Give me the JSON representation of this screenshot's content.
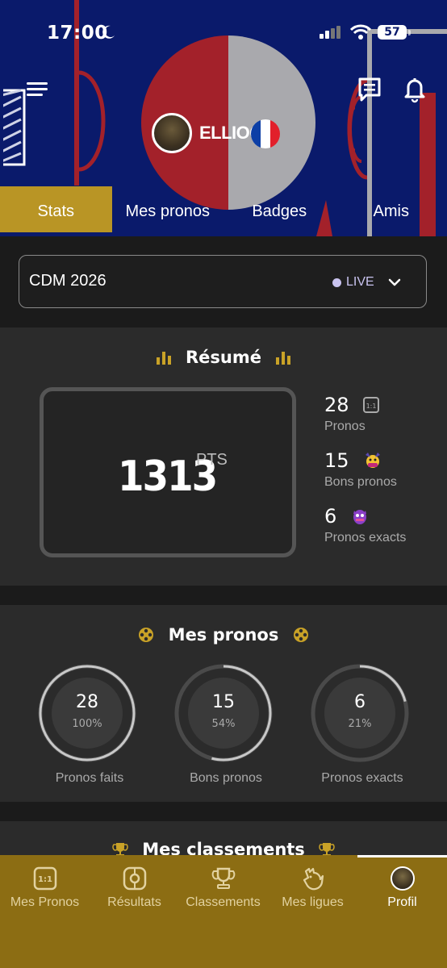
{
  "status_bar": {
    "time": "17:00",
    "battery": "57"
  },
  "profile": {
    "username": "ELLIOOT",
    "country": "France"
  },
  "tabs": [
    {
      "label": "Stats",
      "active": true
    },
    {
      "label": "Mes pronos",
      "active": false
    },
    {
      "label": "Badges",
      "active": false
    },
    {
      "label": "Amis",
      "active": false
    }
  ],
  "competition": {
    "name": "CDM 2026",
    "status": "LIVE"
  },
  "summary": {
    "title": "Résumé",
    "points": "1313",
    "points_unit": "PTS",
    "stats": [
      {
        "value": "28",
        "label": "Pronos",
        "icon": "one-one-score-icon"
      },
      {
        "value": "15",
        "label": "Bons pronos",
        "icon": "mascot-icon"
      },
      {
        "value": "6",
        "label": "Pronos exacts",
        "icon": "monster-icon"
      }
    ]
  },
  "my_pronos": {
    "title": "Mes pronos",
    "rings": [
      {
        "value": "28",
        "percent": "100%",
        "label": "Pronos faits",
        "fraction": 1.0
      },
      {
        "value": "15",
        "percent": "54%",
        "label": "Bons pronos",
        "fraction": 0.54
      },
      {
        "value": "6",
        "percent": "21%",
        "label": "Pronos exacts",
        "fraction": 0.21
      }
    ]
  },
  "rankings": {
    "title": "Mes classements"
  },
  "bottom_nav": [
    {
      "label": "Mes Pronos",
      "icon": "score-icon",
      "active": false
    },
    {
      "label": "Résultats",
      "icon": "results-icon",
      "active": false
    },
    {
      "label": "Classements",
      "icon": "trophy-icon",
      "active": false
    },
    {
      "label": "Mes ligues",
      "icon": "rooster-icon",
      "active": false
    },
    {
      "label": "Profil",
      "icon": "avatar-icon",
      "active": true
    }
  ],
  "colors": {
    "accent": "#b99525",
    "nav_bg": "#8c6d13",
    "hero_bg": "#0a1a6b",
    "live": "#c9c3ef"
  }
}
